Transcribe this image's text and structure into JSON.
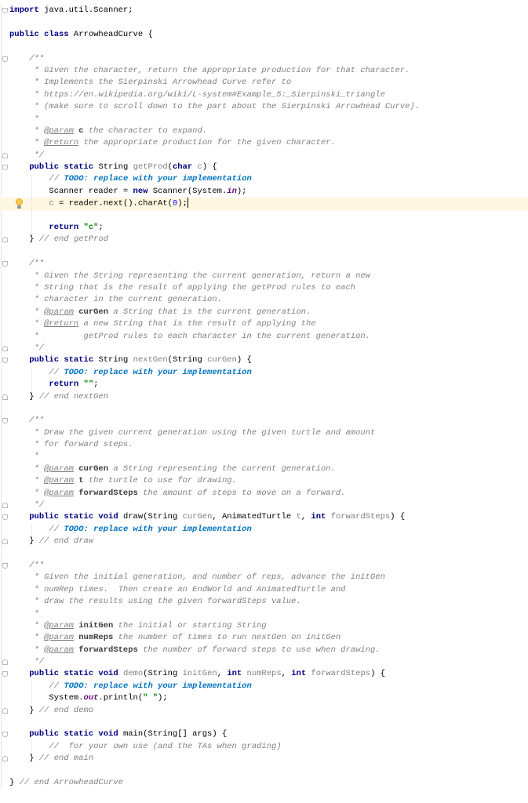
{
  "editor": {
    "current_line": 16,
    "lines": [
      {
        "fold": "open",
        "t": [
          [
            "k",
            "import"
          ],
          [
            "x",
            " java.util.Scanner;"
          ]
        ]
      },
      {
        "t": []
      },
      {
        "t": [
          [
            "k",
            "public class"
          ],
          [
            "x",
            " ArrowheadCurve {"
          ]
        ]
      },
      {
        "t": []
      },
      {
        "fold": "open",
        "t": [
          [
            "x",
            "    "
          ],
          [
            "c",
            "/**"
          ]
        ]
      },
      {
        "t": [
          [
            "c",
            "     * Given the character, return the appropriate production for that character."
          ]
        ]
      },
      {
        "t": [
          [
            "c",
            "     * Implements the Sierpinski Arrowhead Curve refer to"
          ]
        ]
      },
      {
        "t": [
          [
            "c",
            "     * https://en.wikipedia.org/wiki/L-system#Example_5:_Sierpinski_triangle"
          ]
        ]
      },
      {
        "t": [
          [
            "c",
            "     * (make sure to scroll down to the part about the Sierpinski Arrowhead Curve)."
          ]
        ]
      },
      {
        "t": [
          [
            "c",
            "     *"
          ]
        ]
      },
      {
        "t": [
          [
            "c",
            "     * "
          ],
          [
            "d",
            "@param"
          ],
          [
            "p",
            " c"
          ],
          [
            "c",
            " the character to expand."
          ]
        ]
      },
      {
        "t": [
          [
            "c",
            "     * "
          ],
          [
            "d",
            "@return"
          ],
          [
            "c",
            " the appropriate production for the given character."
          ]
        ]
      },
      {
        "fold": "close",
        "t": [
          [
            "c",
            "     */"
          ]
        ]
      },
      {
        "fold": "open",
        "t": [
          [
            "x",
            "    "
          ],
          [
            "k",
            "public static"
          ],
          [
            "x",
            " String "
          ],
          [
            "g",
            "getProd"
          ],
          [
            "x",
            "("
          ],
          [
            "k",
            "char"
          ],
          [
            "g",
            " c"
          ],
          [
            "x",
            ") {"
          ]
        ]
      },
      {
        "t": [
          [
            "x",
            "        "
          ],
          [
            "c",
            "// "
          ],
          [
            "t",
            "TODO: replace with your implementation"
          ]
        ]
      },
      {
        "t": [
          [
            "x",
            "        Scanner reader = "
          ],
          [
            "k",
            "new"
          ],
          [
            "x",
            " Scanner(System."
          ],
          [
            "f",
            "in"
          ],
          [
            "x",
            ");"
          ]
        ]
      },
      {
        "bulb": true,
        "caret": true,
        "t": [
          [
            "x",
            "        "
          ],
          [
            "g",
            "c"
          ],
          [
            "x",
            " = reader.next().charAt("
          ],
          [
            "n",
            "0"
          ],
          [
            "x",
            ");"
          ]
        ]
      },
      {
        "t": []
      },
      {
        "t": [
          [
            "x",
            "        "
          ],
          [
            "k",
            "return"
          ],
          [
            "x",
            " "
          ],
          [
            "s",
            "\"c\""
          ],
          [
            "x",
            ";"
          ]
        ]
      },
      {
        "fold": "close",
        "t": [
          [
            "x",
            "    } "
          ],
          [
            "c",
            "// end getProd"
          ]
        ]
      },
      {
        "t": []
      },
      {
        "fold": "open",
        "t": [
          [
            "x",
            "    "
          ],
          [
            "c",
            "/**"
          ]
        ]
      },
      {
        "t": [
          [
            "c",
            "     * Given the String representing the current generation, return a new"
          ]
        ]
      },
      {
        "t": [
          [
            "c",
            "     * String that is the result of applying the getProd rules to each"
          ]
        ]
      },
      {
        "t": [
          [
            "c",
            "     * character in the current generation."
          ]
        ]
      },
      {
        "t": [
          [
            "c",
            "     * "
          ],
          [
            "d",
            "@param"
          ],
          [
            "p",
            " curGen"
          ],
          [
            "c",
            " a String that is the current generation."
          ]
        ]
      },
      {
        "t": [
          [
            "c",
            "     * "
          ],
          [
            "d",
            "@return"
          ],
          [
            "c",
            " a new String that is the result of applying the"
          ]
        ]
      },
      {
        "t": [
          [
            "c",
            "     *         getProd rules to each character in the current generation."
          ]
        ]
      },
      {
        "fold": "close",
        "t": [
          [
            "c",
            "     */"
          ]
        ]
      },
      {
        "fold": "open",
        "t": [
          [
            "x",
            "    "
          ],
          [
            "k",
            "public static"
          ],
          [
            "x",
            " String "
          ],
          [
            "g",
            "nextGen"
          ],
          [
            "x",
            "(String "
          ],
          [
            "g",
            "curGen"
          ],
          [
            "x",
            ") {"
          ]
        ]
      },
      {
        "t": [
          [
            "x",
            "        "
          ],
          [
            "c",
            "// "
          ],
          [
            "t",
            "TODO: replace with your implementation"
          ]
        ]
      },
      {
        "t": [
          [
            "x",
            "        "
          ],
          [
            "k",
            "return"
          ],
          [
            "x",
            " "
          ],
          [
            "s",
            "\"\""
          ],
          [
            "x",
            ";"
          ]
        ]
      },
      {
        "fold": "close",
        "t": [
          [
            "x",
            "    } "
          ],
          [
            "c",
            "// end nextGen"
          ]
        ]
      },
      {
        "t": []
      },
      {
        "fold": "open",
        "t": [
          [
            "x",
            "    "
          ],
          [
            "c",
            "/**"
          ]
        ]
      },
      {
        "t": [
          [
            "c",
            "     * Draw the given current generation using the given turtle and amount"
          ]
        ]
      },
      {
        "t": [
          [
            "c",
            "     * for forward steps."
          ]
        ]
      },
      {
        "t": [
          [
            "c",
            "     *"
          ]
        ]
      },
      {
        "t": [
          [
            "c",
            "     * "
          ],
          [
            "d",
            "@param"
          ],
          [
            "p",
            " curGen"
          ],
          [
            "c",
            " a String representing the current generation."
          ]
        ]
      },
      {
        "t": [
          [
            "c",
            "     * "
          ],
          [
            "d",
            "@param"
          ],
          [
            "p",
            " t"
          ],
          [
            "c",
            " the turtle to use for drawing."
          ]
        ]
      },
      {
        "t": [
          [
            "c",
            "     * "
          ],
          [
            "d",
            "@param"
          ],
          [
            "p",
            " forwardSteps"
          ],
          [
            "c",
            " the amount of steps to move on a forward."
          ]
        ]
      },
      {
        "fold": "close",
        "t": [
          [
            "c",
            "     */"
          ]
        ]
      },
      {
        "fold": "open",
        "t": [
          [
            "x",
            "    "
          ],
          [
            "k",
            "public static void"
          ],
          [
            "x",
            " draw(String "
          ],
          [
            "g",
            "curGen"
          ],
          [
            "x",
            ", AnimatedTurtle "
          ],
          [
            "g",
            "t"
          ],
          [
            "x",
            ", "
          ],
          [
            "k",
            "int"
          ],
          [
            "x",
            " "
          ],
          [
            "g",
            "forwardSteps"
          ],
          [
            "x",
            ") {"
          ]
        ]
      },
      {
        "t": [
          [
            "x",
            "        "
          ],
          [
            "c",
            "// "
          ],
          [
            "t",
            "TODO: replace with your implementation"
          ]
        ]
      },
      {
        "fold": "close",
        "t": [
          [
            "x",
            "    } "
          ],
          [
            "c",
            "// end draw"
          ]
        ]
      },
      {
        "t": []
      },
      {
        "fold": "open",
        "t": [
          [
            "x",
            "    "
          ],
          [
            "c",
            "/**"
          ]
        ]
      },
      {
        "t": [
          [
            "c",
            "     * Given the initial generation, and number of reps, advance the initGen"
          ]
        ]
      },
      {
        "t": [
          [
            "c",
            "     * numRep times.  Then create an EndWorld and AnimatedTurtle and"
          ]
        ]
      },
      {
        "t": [
          [
            "c",
            "     * draw the results using the given forwardSteps value."
          ]
        ]
      },
      {
        "t": [
          [
            "c",
            "     *"
          ]
        ]
      },
      {
        "t": [
          [
            "c",
            "     * "
          ],
          [
            "d",
            "@param"
          ],
          [
            "p",
            " initGen"
          ],
          [
            "c",
            " the initial or starting String"
          ]
        ]
      },
      {
        "t": [
          [
            "c",
            "     * "
          ],
          [
            "d",
            "@param"
          ],
          [
            "p",
            " numReps"
          ],
          [
            "c",
            " the number of times to run nextGen on initGen"
          ]
        ]
      },
      {
        "t": [
          [
            "c",
            "     * "
          ],
          [
            "d",
            "@param"
          ],
          [
            "p",
            " forwardSteps"
          ],
          [
            "c",
            " the number of forward steps to use when drawing."
          ]
        ]
      },
      {
        "fold": "close",
        "t": [
          [
            "c",
            "     */"
          ]
        ]
      },
      {
        "fold": "open",
        "t": [
          [
            "x",
            "    "
          ],
          [
            "k",
            "public static void"
          ],
          [
            "x",
            " "
          ],
          [
            "g",
            "demo"
          ],
          [
            "x",
            "(String "
          ],
          [
            "g",
            "initGen"
          ],
          [
            "x",
            ", "
          ],
          [
            "k",
            "int"
          ],
          [
            "x",
            " "
          ],
          [
            "g",
            "numReps"
          ],
          [
            "x",
            ", "
          ],
          [
            "k",
            "int"
          ],
          [
            "x",
            " "
          ],
          [
            "g",
            "forwardSteps"
          ],
          [
            "x",
            ") {"
          ]
        ]
      },
      {
        "t": [
          [
            "x",
            "        "
          ],
          [
            "c",
            "// "
          ],
          [
            "t",
            "TODO: replace with your implementation"
          ]
        ]
      },
      {
        "t": [
          [
            "x",
            "        System."
          ],
          [
            "f",
            "out"
          ],
          [
            "x",
            ".println("
          ],
          [
            "s",
            "\" \""
          ],
          [
            "x",
            ");"
          ]
        ]
      },
      {
        "fold": "close",
        "t": [
          [
            "x",
            "    } "
          ],
          [
            "c",
            "// end demo"
          ]
        ]
      },
      {
        "t": []
      },
      {
        "fold": "open",
        "t": [
          [
            "x",
            "    "
          ],
          [
            "k",
            "public static void"
          ],
          [
            "x",
            " main(String[] args) {"
          ]
        ]
      },
      {
        "t": [
          [
            "x",
            "        "
          ],
          [
            "c",
            "//  for your own use (and the TAs when grading)"
          ]
        ]
      },
      {
        "fold": "close",
        "t": [
          [
            "x",
            "    } "
          ],
          [
            "c",
            "// end main"
          ]
        ]
      },
      {
        "t": []
      },
      {
        "t": [
          [
            "x",
            "} "
          ],
          [
            "c",
            "// end ArrowheadCurve"
          ]
        ]
      }
    ]
  }
}
